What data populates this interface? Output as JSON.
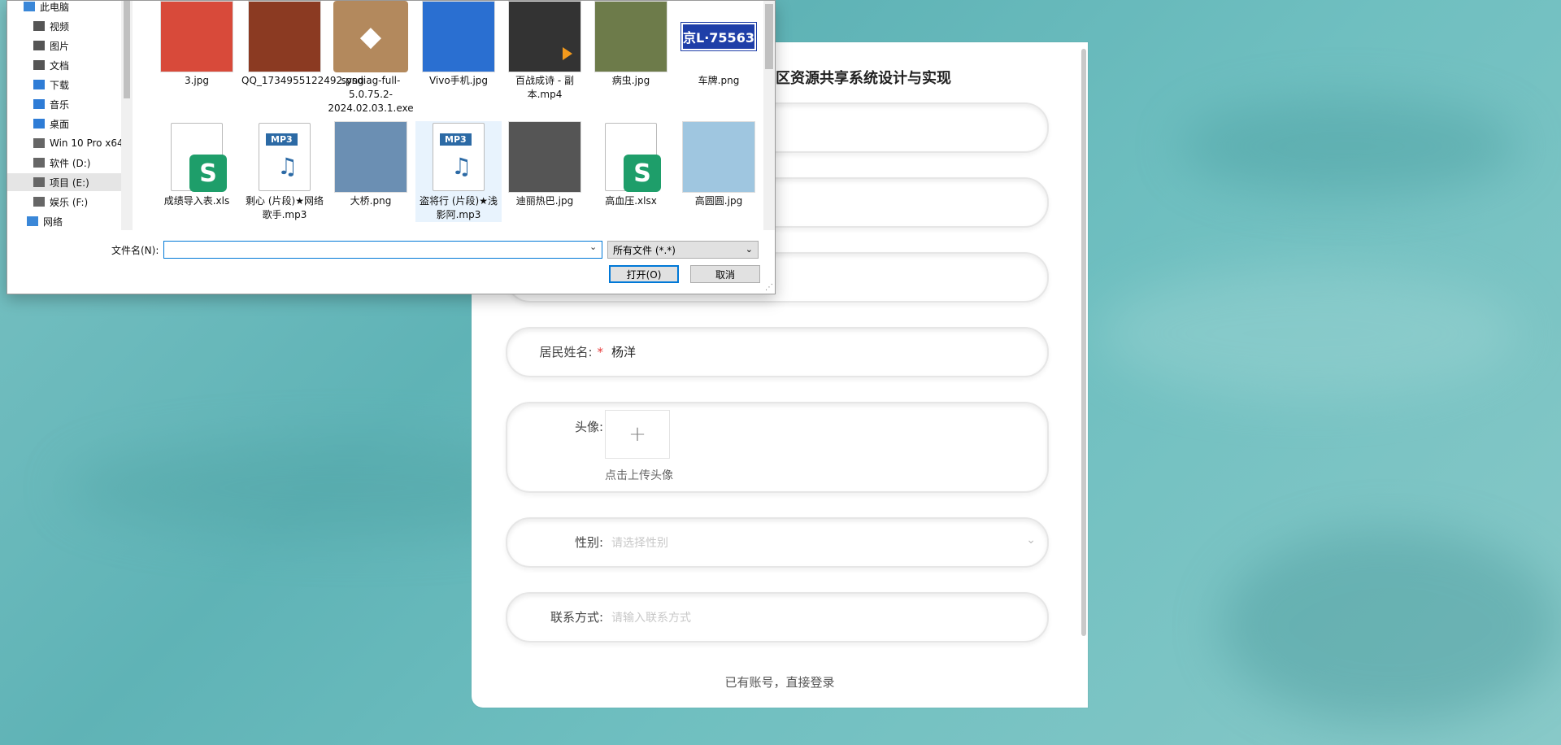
{
  "dialog": {
    "nav_items": [
      {
        "label": "此电脑",
        "icon": "computer-icon"
      },
      {
        "label": "视频",
        "icon": "video-icon"
      },
      {
        "label": "图片",
        "icon": "pictures-icon"
      },
      {
        "label": "文档",
        "icon": "documents-icon"
      },
      {
        "label": "下载",
        "icon": "download-icon"
      },
      {
        "label": "音乐",
        "icon": "music-icon"
      },
      {
        "label": "桌面",
        "icon": "desktop-icon"
      },
      {
        "label": "Win 10 Pro x64",
        "icon": "drive-icon"
      },
      {
        "label": "软件 (D:)",
        "icon": "drive-icon"
      },
      {
        "label": "项目 (E:)",
        "icon": "drive-icon"
      },
      {
        "label": "娱乐 (F:)",
        "icon": "drive-icon"
      },
      {
        "label": "网络",
        "icon": "network-icon"
      }
    ],
    "files": [
      {
        "name": "3.jpg",
        "kind": "image",
        "color": "#d84a3a"
      },
      {
        "name": "QQ_1734955122492.png",
        "kind": "image",
        "color": "#8b3a22"
      },
      {
        "name": "sysdiag-full-5.0.75.2-2024.02.03.1.exe",
        "kind": "exe",
        "color": "#b3895d"
      },
      {
        "name": "Vivo手机.jpg",
        "kind": "image",
        "color": "#2a6fd1"
      },
      {
        "name": "百战成诗 - 副本.mp4",
        "kind": "video",
        "color": "#333"
      },
      {
        "name": "病虫.jpg",
        "kind": "image",
        "color": "#6d7b4a"
      },
      {
        "name": "车牌.png",
        "kind": "plate",
        "color": "#1f3fa8",
        "plate_text": "京L·75563"
      },
      {
        "name": "成绩导入表.xls",
        "kind": "sheet",
        "color": "#1e9e6a"
      },
      {
        "name": "剩心 (片段)★网络歌手.mp3",
        "kind": "mp3",
        "color": "#2c6aa5"
      },
      {
        "name": "大桥.png",
        "kind": "image",
        "color": "#6b8fb3"
      },
      {
        "name": "盗将行 (片段)★浅影阿.mp3",
        "kind": "mp3",
        "color": "#2c6aa5"
      },
      {
        "name": "迪丽热巴.jpg",
        "kind": "image",
        "color": "#555"
      },
      {
        "name": "高血压.xlsx",
        "kind": "sheet",
        "color": "#1e9e6a"
      },
      {
        "name": "高圆圆.jpg",
        "kind": "image",
        "color": "#9fc6e0"
      }
    ],
    "filename_label": "文件名(N):",
    "filename_value": "",
    "type_value": "所有文件 (*.*)",
    "open_label": "打开(O)",
    "cancel_label": "取消",
    "mp3_tag": "MP3",
    "sheet_letter": "S"
  },
  "form": {
    "title": "社区资源共享系统设计与实现",
    "name_label": "居民姓名:",
    "name_value": "杨洋",
    "required_mark": "*",
    "avatar_label": "头像:",
    "upload_tip": "点击上传头像",
    "gender_label": "性别:",
    "gender_placeholder": "请选择性别",
    "contact_label": "联系方式:",
    "contact_placeholder": "请输入联系方式",
    "login_link": "已有账号，直接登录"
  }
}
